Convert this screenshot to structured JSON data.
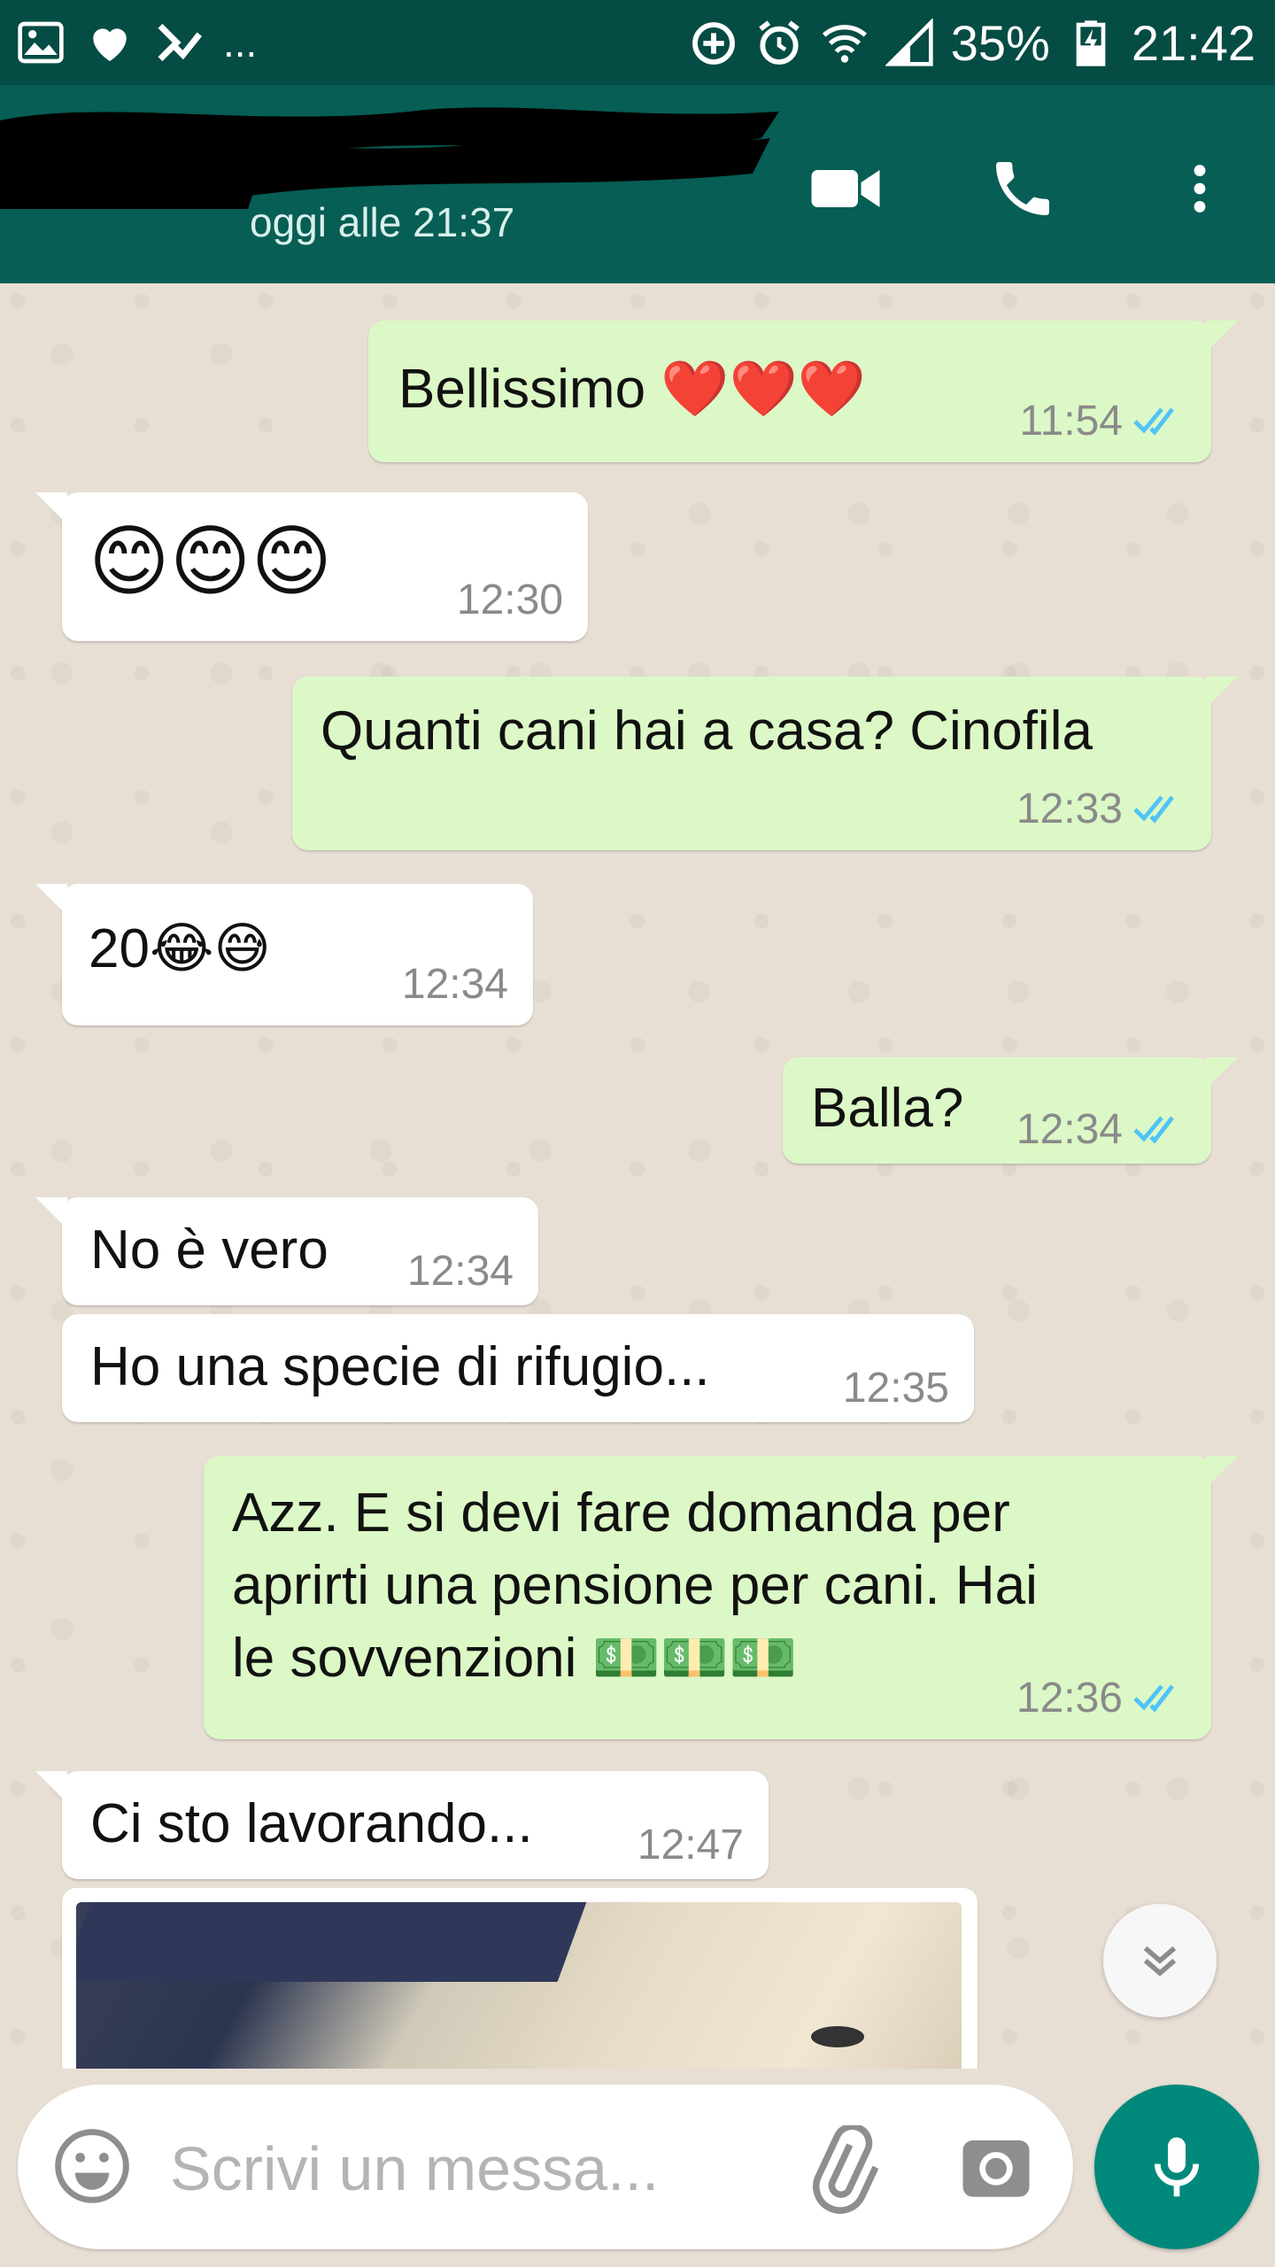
{
  "status_bar": {
    "notif_more": "...",
    "battery": "35%",
    "time": "21:42"
  },
  "header": {
    "last_seen": "oggi alle 21:37"
  },
  "messages": [
    {
      "dir": "out",
      "text": "Bellissimo ❤️❤️❤️",
      "time": "11:54",
      "read": true
    },
    {
      "dir": "in",
      "text": "😊😊😊",
      "time": "12:30"
    },
    {
      "dir": "out",
      "text": "Quanti cani hai a casa? Cinofila",
      "time": "12:33",
      "read": true
    },
    {
      "dir": "in",
      "text": "20😂😅",
      "time": "12:34"
    },
    {
      "dir": "out",
      "text": "Balla?",
      "time": "12:34",
      "read": true
    },
    {
      "dir": "in",
      "text": "No è vero",
      "time": "12:34"
    },
    {
      "dir": "in",
      "text": "Ho una specie di rifugio...",
      "time": "12:35"
    },
    {
      "dir": "out",
      "text": "Azz. E si devi fare domanda per\naprirti una pensione per cani. Hai\nle sovvenzioni 💵💵💵",
      "time": "12:36",
      "read": true
    },
    {
      "dir": "in",
      "text": "Ci sto lavorando...",
      "time": "12:47"
    }
  ],
  "composer": {
    "placeholder": "Scrivi un messa..."
  },
  "colors": {
    "header": "#075e54",
    "status_bar": "#054c44",
    "outgoing": "#dcf8c6",
    "incoming": "#ffffff",
    "ticks": "#4fc3f7",
    "mic": "#00897b"
  }
}
